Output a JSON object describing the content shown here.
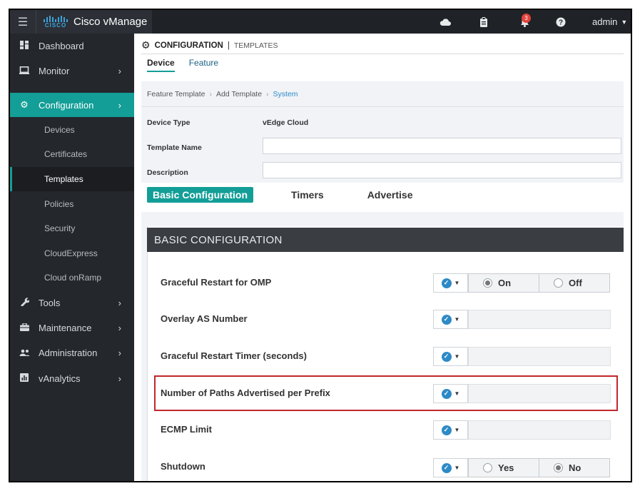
{
  "app": {
    "menu_icon": "hamburger-icon",
    "logo_text": "CISCO",
    "title": "Cisco vManage"
  },
  "topbar": {
    "cloud_icon": "cloud-icon",
    "tasks_icon": "clipboard-icon",
    "alerts_icon": "bell-icon",
    "alerts_count": "3",
    "help_icon": "help-icon",
    "user": "admin"
  },
  "sidebar": {
    "items": [
      {
        "label": "Dashboard",
        "icon": "dashboard-icon"
      },
      {
        "label": "Monitor",
        "icon": "monitor-icon"
      },
      {
        "label": "Configuration",
        "icon": "gear-icon"
      },
      {
        "label": "Tools",
        "icon": "wrench-icon"
      },
      {
        "label": "Maintenance",
        "icon": "briefcase-icon"
      },
      {
        "label": "Administration",
        "icon": "users-icon"
      },
      {
        "label": "vAnalytics",
        "icon": "analytics-icon"
      }
    ],
    "sub_items": [
      "Devices",
      "Certificates",
      "Templates",
      "Policies",
      "Security",
      "CloudExpress",
      "Cloud onRamp"
    ]
  },
  "page": {
    "title": "CONFIGURATION",
    "subtitle": "TEMPLATES",
    "tabs": [
      "Device",
      "Feature"
    ]
  },
  "breadcrumb": {
    "items": [
      "Feature Template",
      "Add Template",
      "System"
    ]
  },
  "form": {
    "device_type_label": "Device Type",
    "device_type_value": "vEdge Cloud",
    "template_name_label": "Template Name",
    "template_name_value": "",
    "description_label": "Description",
    "description_value": ""
  },
  "section_tabs": [
    "Basic Configuration",
    "Timers",
    "Advertise"
  ],
  "section": {
    "title": "BASIC CONFIGURATION",
    "rows": [
      {
        "label": "Graceful Restart for OMP",
        "options": [
          "On",
          "Off"
        ],
        "selected": "On"
      },
      {
        "label": "Overlay AS Number",
        "value": ""
      },
      {
        "label": "Graceful Restart Timer (seconds)",
        "value": ""
      },
      {
        "label": "Number of Paths Advertised per Prefix",
        "value": ""
      },
      {
        "label": "ECMP Limit",
        "value": ""
      },
      {
        "label": "Shutdown",
        "options": [
          "Yes",
          "No"
        ],
        "selected": "No"
      }
    ]
  },
  "colors": {
    "accent": "#139e97",
    "sidebar": "#24272c",
    "topbar": "#1f2226",
    "highlight": "#c0272d",
    "link": "#2d8ac7"
  }
}
